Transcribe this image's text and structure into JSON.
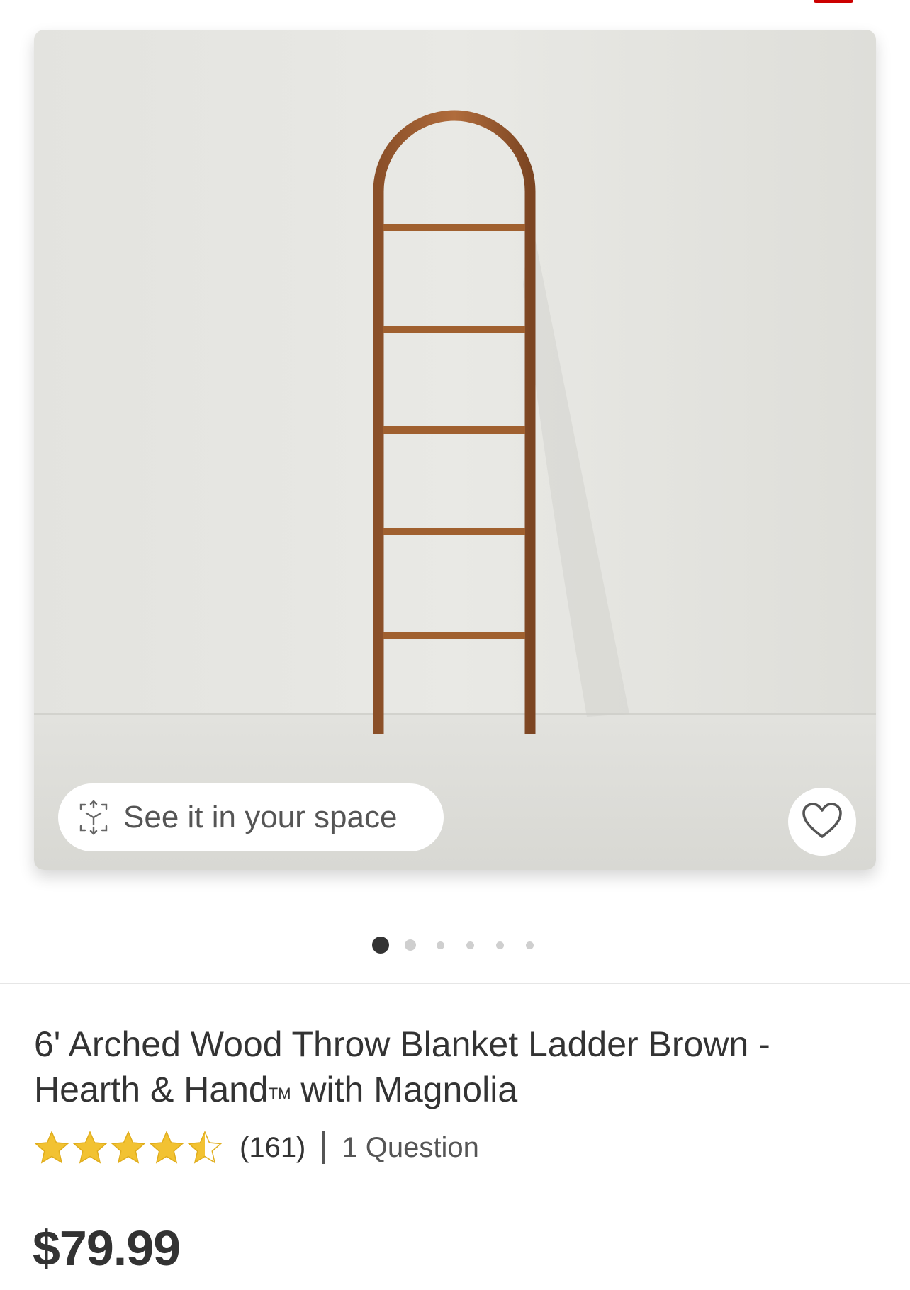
{
  "colors": {
    "accent": "#cc0000",
    "star": "#f2c232",
    "text": "#333333"
  },
  "product": {
    "title": "6' Arched Wood Throw Blanket Ladder Brown - Hearth & Hand",
    "title_mark": "TM",
    "title_suffix": " with Magnolia",
    "rating": 4.5,
    "rating_count": "(161)",
    "questions": "1 Question",
    "price": "$79.99"
  },
  "gallery": {
    "image_subject": "arched wooden ladder",
    "ar_button_label": "See it in your space",
    "ar_icon": "ar-cube-icon",
    "favorite_icon": "heart-icon",
    "image_count": 6,
    "active_index": 0
  }
}
